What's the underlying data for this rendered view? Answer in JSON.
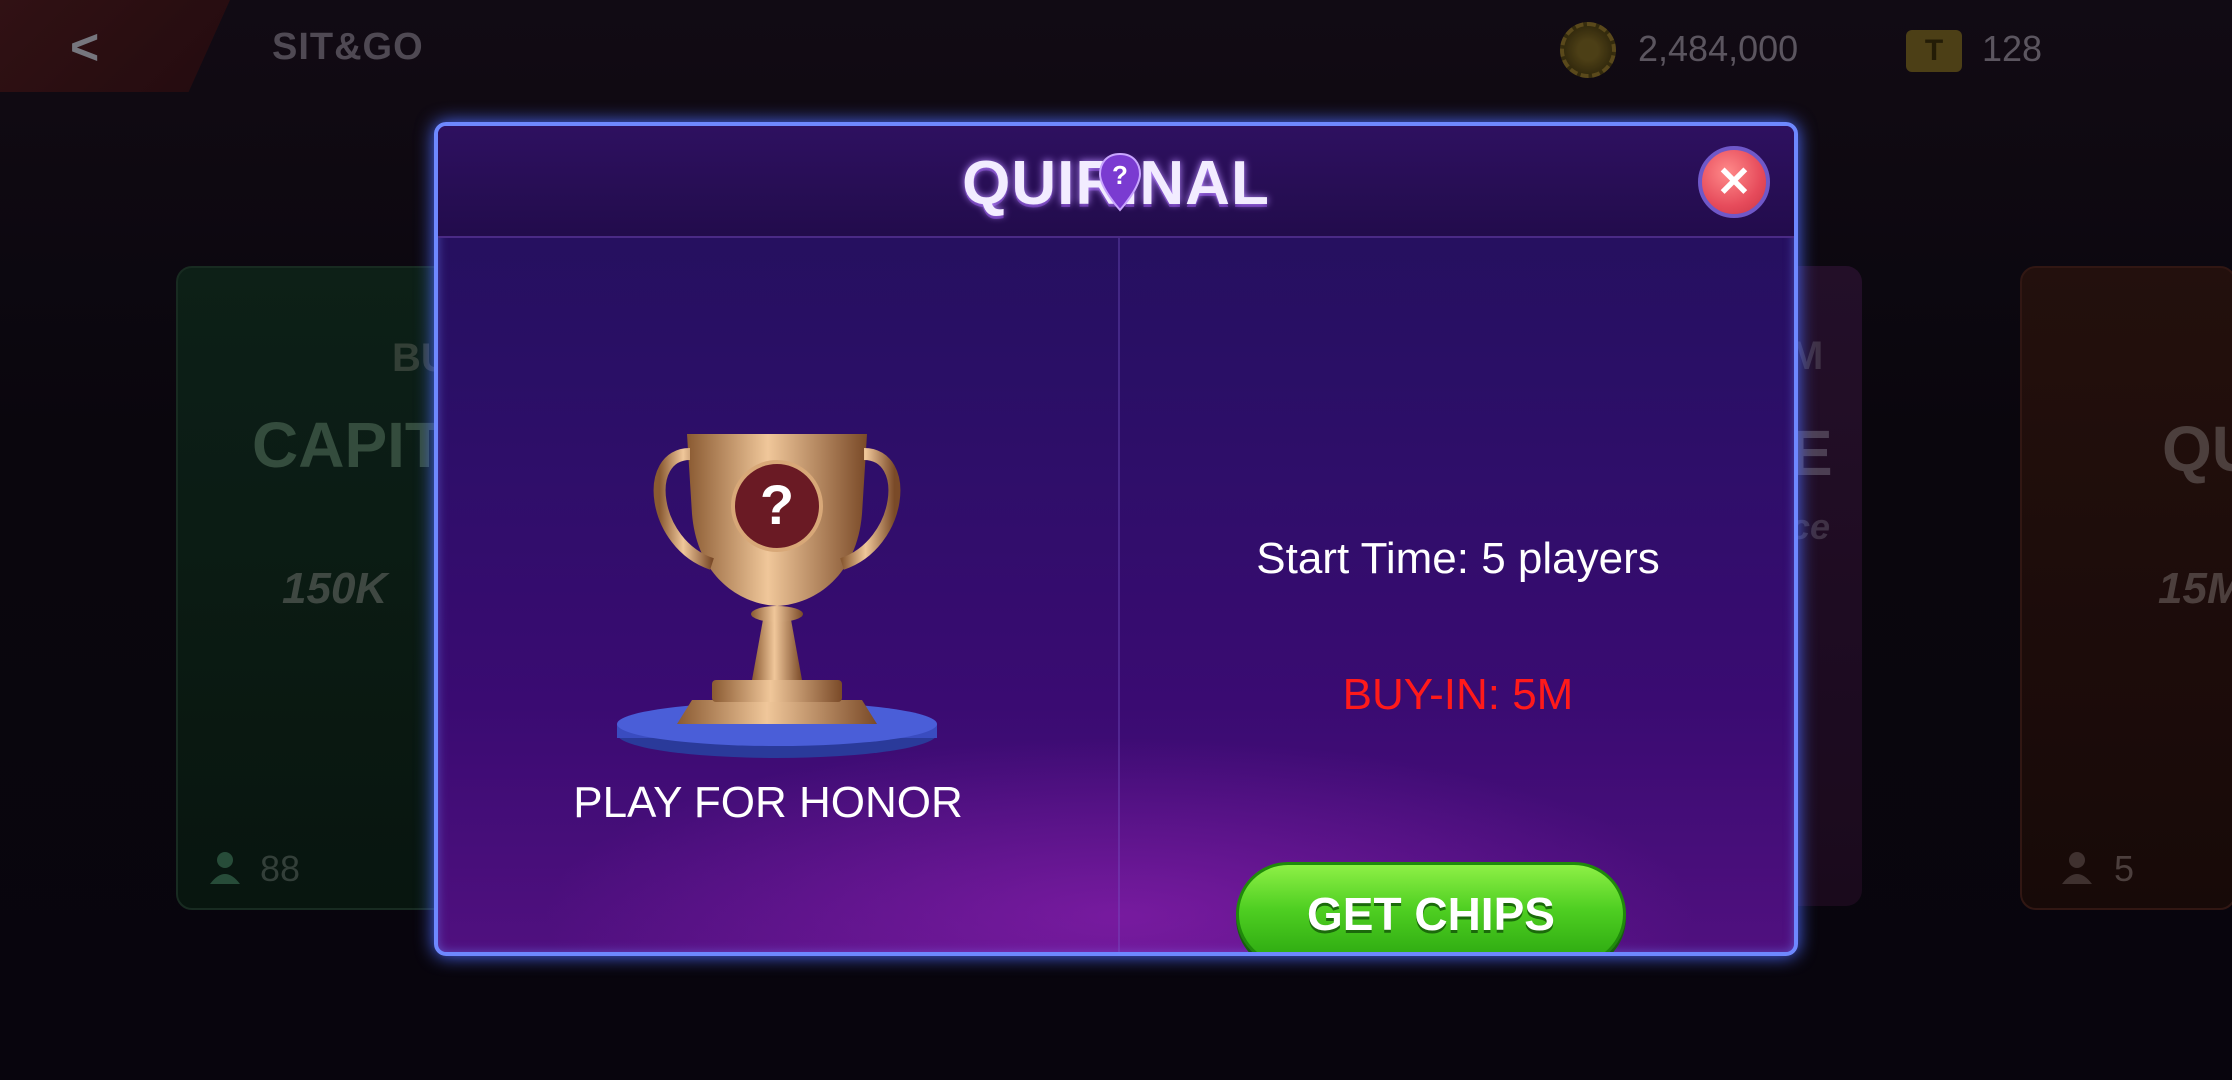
{
  "topbar": {
    "back_icon": "chevron-left-icon",
    "title": "SIT&GO",
    "chip_balance": "2,484,000",
    "ticket_count": "128"
  },
  "background_cards": [
    {
      "label_top": "BU",
      "label_main": "CAPIT",
      "stake": "150K",
      "players": "88",
      "color": "#10261c"
    },
    {
      "label_top": "M",
      "label_main": "E",
      "stake": "ce",
      "color": "#2a1230"
    },
    {
      "label_main": "QU",
      "stake": "15M",
      "players": "5",
      "color": "#2a1310"
    }
  ],
  "modal": {
    "title": "QUIRINAL",
    "close_icon": "close-icon",
    "trophy_icon": "trophy-question-icon",
    "honor_label": "PLAY FOR HONOR",
    "start_time": "Start Time: 5 players",
    "buy_in": "BUY-IN: 5M",
    "get_chips_label": "GET CHIPS"
  },
  "colors": {
    "modal_border": "#6e88ff",
    "buy_in_text": "#ff1a1a",
    "get_chips_button": "#4fcf22",
    "close_button": "#e64b5b"
  }
}
